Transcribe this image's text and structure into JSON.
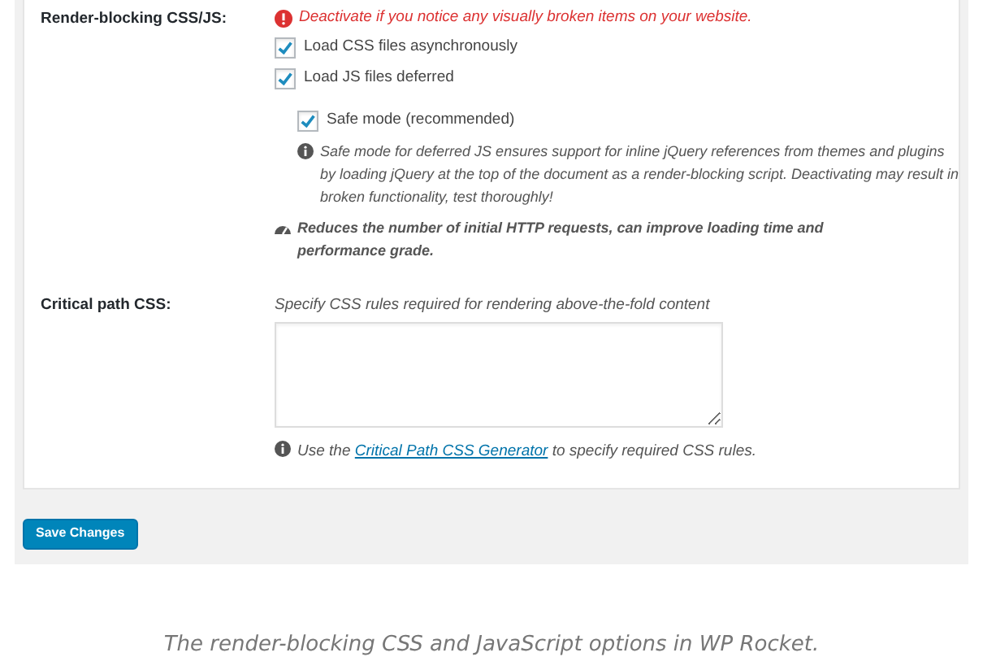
{
  "sections": [
    {
      "label": "Render-blocking CSS/JS:",
      "warning": "Deactivate if you notice any visually broken items on your website.",
      "options": [
        {
          "label": "Load CSS files asynchronously",
          "checked": true
        },
        {
          "label": "Load JS files deferred",
          "checked": true
        }
      ],
      "sub_option": {
        "label": "Safe mode (recommended)",
        "checked": true,
        "note": "Safe mode for deferred JS ensures support for inline jQuery references from themes and plugins by loading jQuery at the top of the document as a render-blocking script. Deactivating may result in broken functionality, test thoroughly!"
      },
      "benefit": "Reduces the number of initial HTTP requests, can improve loading time and performance grade."
    },
    {
      "label": "Critical path CSS:",
      "description": "Specify CSS rules required for rendering above-the-fold content",
      "help": {
        "before": "Use the ",
        "link": "Critical Path CSS Generator",
        "after": " to specify required CSS rules."
      }
    }
  ],
  "save_button": "Save Changes",
  "caption": "The render-blocking CSS and JavaScript options in WP Rocket."
}
